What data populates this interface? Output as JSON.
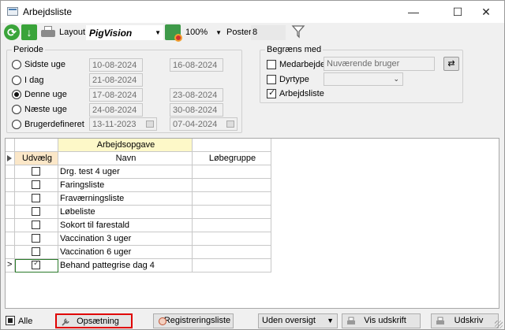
{
  "window": {
    "title": "Arbejdsliste",
    "controls": {
      "minimize": "—",
      "maximize": "☐",
      "close": "✕"
    }
  },
  "toolbar": {
    "layout_label": "Layout",
    "layout_value": "PigVision",
    "zoom_value": "100%",
    "poster_label": "Poster",
    "poster_value": "8"
  },
  "periode": {
    "legend": "Periode",
    "options": [
      {
        "label": "Sidste uge",
        "from": "10-08-2024",
        "to": "16-08-2024",
        "selected": false
      },
      {
        "label": "I dag",
        "from": "21-08-2024",
        "to": "",
        "selected": false
      },
      {
        "label": "Denne uge",
        "from": "17-08-2024",
        "to": "23-08-2024",
        "selected": true
      },
      {
        "label": "Næste uge",
        "from": "24-08-2024",
        "to": "30-08-2024",
        "selected": false
      },
      {
        "label": "Brugerdefineret",
        "from": "13-11-2023",
        "to": "07-04-2024",
        "selected": false
      }
    ]
  },
  "begraens": {
    "legend": "Begræns med",
    "medarbejder_label": "Medarbejder",
    "medarbejder_value": "Nuværende bruger",
    "medarbejder_checked": false,
    "dyrtype_label": "Dyrtype",
    "dyrtype_checked": false,
    "arbejdsliste_label": "Arbejdsliste",
    "arbejdsliste_checked": true
  },
  "grid": {
    "band_header": "Arbejdsopgave",
    "columns": [
      "Udvælg",
      "Navn",
      "Løbegruppe"
    ],
    "rows": [
      {
        "navn": "Drg. test 4 uger",
        "checked": false
      },
      {
        "navn": "Faringsliste",
        "checked": false
      },
      {
        "navn": "Fraværningsliste",
        "checked": false
      },
      {
        "navn": "Løbeliste",
        "checked": false
      },
      {
        "navn": "Sokort til farestald",
        "checked": false
      },
      {
        "navn": "Vaccination 3 uger",
        "checked": false
      },
      {
        "navn": "Vaccination 6 uger",
        "checked": false
      },
      {
        "navn": "Behand pattegrise dag 4",
        "checked": true
      }
    ],
    "current_row_pointer": ">"
  },
  "footer": {
    "alle_label": "Alle",
    "opsaetning_label": "Opsætning",
    "registreringsliste_label": "Registreringsliste",
    "oversigt_value": "Uden oversigt",
    "vis_udskrift_label": "Vis udskrift",
    "udskriv_label": "Udskriv"
  },
  "colors": {
    "band_header_bg": "#fdf8c8",
    "udvaelg_header_bg": "#fbe7c8",
    "highlight_border": "#e00000",
    "green_icon": "#3aa43a"
  }
}
